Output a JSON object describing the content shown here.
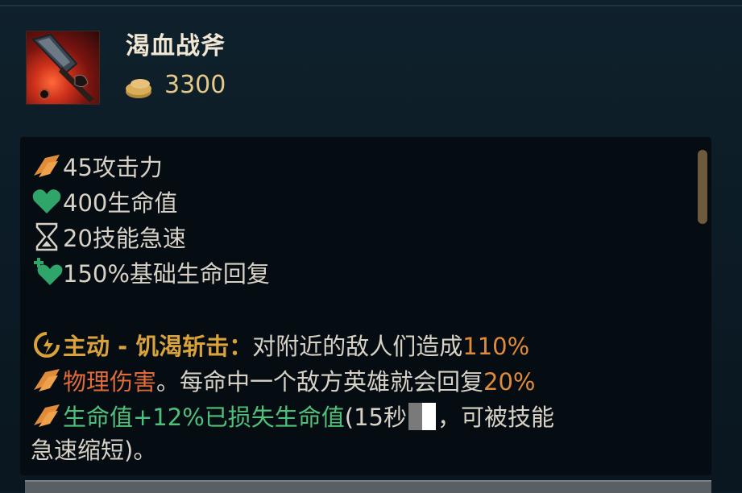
{
  "item": {
    "name": "渴血战斧",
    "cost": "3300",
    "icon": "axe-item-icon"
  },
  "stats": [
    {
      "icon": "attack-damage-icon",
      "text": "45攻击力"
    },
    {
      "icon": "health-heart-icon",
      "text": "400生命值"
    },
    {
      "icon": "hourglass-icon",
      "text": "20技能急速"
    },
    {
      "icon": "health-regen-icon",
      "text": "150%基础生命回复"
    }
  ],
  "active": {
    "label": "主动 - 饥渴斩击：",
    "text1": "对附近的敌人们造成",
    "pct1": "110%",
    "phys": "物理伤害",
    "text2": "。每命中一个敌方英雄就会回复",
    "pct2": "20%",
    "heal": "生命值+12%已损失生命值",
    "cd_open": "(15秒",
    "cd_close": "，可被技能",
    "tail": "急速缩短)。"
  },
  "colors": {
    "gold": "#d9a23a",
    "orange": "#e08b3a",
    "green": "#4fc07a",
    "text": "#d8d2c6"
  }
}
